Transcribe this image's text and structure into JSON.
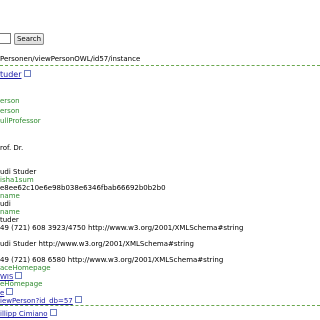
{
  "search": {
    "placeholder": "",
    "button_label": "Search"
  },
  "url": {
    "text": "Personen/viewPersonOWL/id57/instance"
  },
  "entity": {
    "title": "tuder"
  },
  "classes": [
    "erson",
    "erson",
    "ullProfessor"
  ],
  "properties": {
    "title_value": "rof. Dr.",
    "name": "udi Studer",
    "id_prefix": "isha1sum",
    "sha1": "e8ee62c10e6e98b038e6346fbab66692b0b2b0",
    "firstname_key": "name",
    "firstname": "udi",
    "lastname_key": "name",
    "lastname": "tuder",
    "phone": "49 (721) 608 3923/4750 http://www.w3.org/2001/XMLSchema#string",
    "fullname_typed": "udi Studer http://www.w3.org/2001/XMLSchema#string",
    "fax": "49 (721) 608 6580 http://www.w3.org/2001/XMLSchema#string",
    "workplace_label": "aceHomepage",
    "workplace_link": "WIS",
    "homepage_label": "eHomepage",
    "homepage_link": "e",
    "view_link": "iewPerson?id_db=57"
  },
  "next_entity": {
    "title": "illipp Cimiano"
  },
  "colors": {
    "link": "#1a1aa6",
    "property": "#2e8b2e",
    "separator": "#6aa84f"
  }
}
